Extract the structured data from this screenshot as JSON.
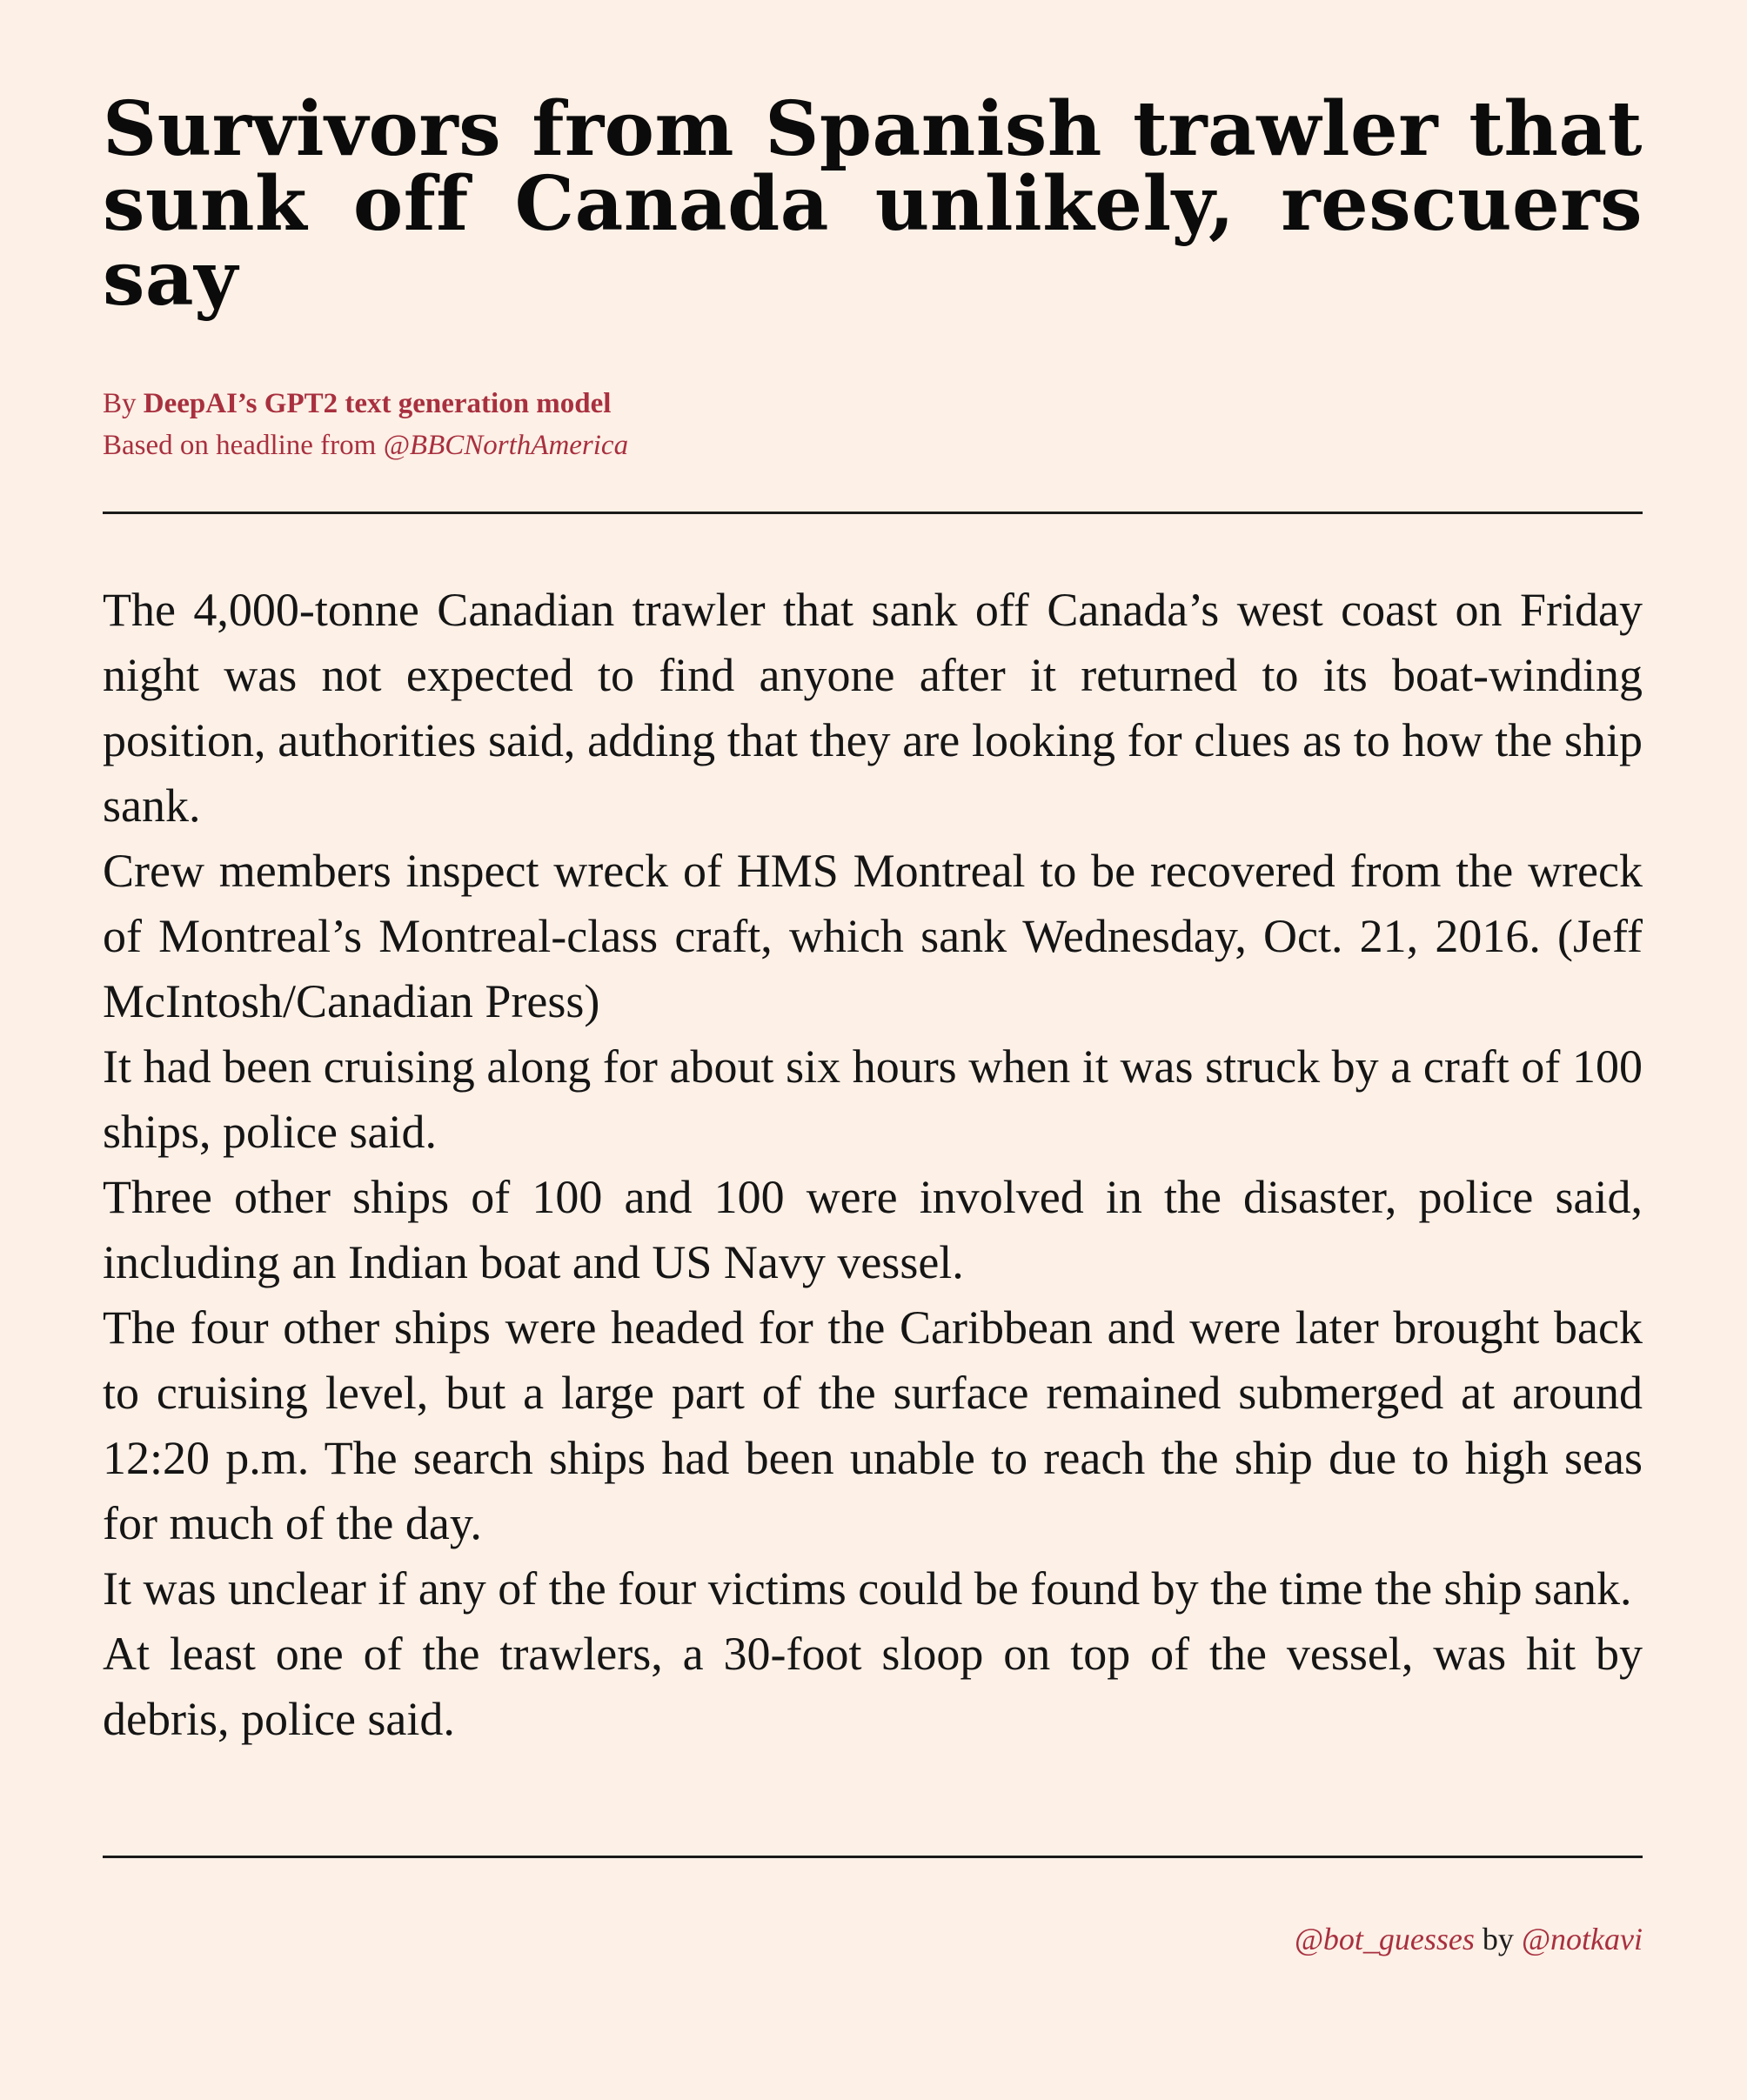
{
  "article": {
    "headline": "Survivors from Spanish trawler that sunk off Canada unlikely, rescuers say",
    "byline": {
      "prefix": "By",
      "author": "DeepAI’s GPT2 text generation model",
      "source_prefix": "Based on headline from",
      "source_handle": "@BBCNorthAmerica"
    },
    "paragraphs": [
      "The 4,000-tonne Canadian trawler that sank off Canada’s west coast on Friday night was not expected to find anyone after it returned to its boat-winding position, authorities said, adding that they are looking for clues as to how the ship sank.",
      "Crew members inspect wreck of HMS Montreal to be recovered from the wreck of Montreal’s Montreal-class craft, which sank Wednesday, Oct. 21, 2016. (Jeff McIntosh/Canadian Press)",
      "It had been cruising along for about six hours when it was struck by a craft of 100 ships, police said.",
      "Three other ships of 100 and 100 were involved in the disaster, police said, including an Indian boat and US Navy vessel.",
      "The four other ships were headed for the Caribbean and were later brought back to cruising level, but a large part of the surface remained submerged at around 12:20 p.m. The search ships had been unable to reach the ship due to high seas for much of the day.",
      "It was unclear if any of the four victims could be found by the time the ship sank.",
      "At least one of the trawlers, a 30-foot sloop on top of the vessel, was hit by debris, police said."
    ]
  },
  "footer": {
    "bot_handle": "@bot_guesses",
    "by": "by",
    "author_handle": "@notkavi"
  },
  "colors": {
    "background": "#fdf0e6",
    "accent": "#a8303f",
    "text": "#111111"
  }
}
